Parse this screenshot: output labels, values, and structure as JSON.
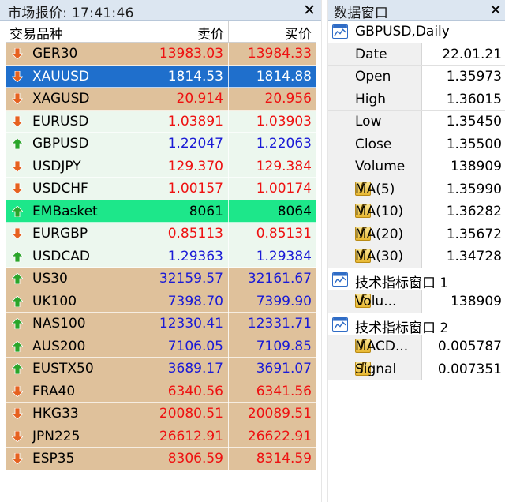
{
  "market_watch": {
    "title": "市场报价: 17:41:46",
    "close_glyph": "✕",
    "columns": {
      "symbol": "交易品种",
      "bid": "卖价",
      "ask": "买价"
    },
    "rows": [
      {
        "symbol": "GER30",
        "bid": "13983.03",
        "ask": "13984.33",
        "direction": "down",
        "bg": "tan",
        "price_color": "red"
      },
      {
        "symbol": "XAUUSD",
        "bid": "1814.53",
        "ask": "1814.88",
        "direction": "down",
        "bg": "blue",
        "price_color": "white"
      },
      {
        "symbol": "XAGUSD",
        "bid": "20.914",
        "ask": "20.956",
        "direction": "down",
        "bg": "tan",
        "price_color": "red"
      },
      {
        "symbol": "EURUSD",
        "bid": "1.03891",
        "ask": "1.03903",
        "direction": "down",
        "bg": "mint",
        "price_color": "red"
      },
      {
        "symbol": "GBPUSD",
        "bid": "1.22047",
        "ask": "1.22063",
        "direction": "up",
        "bg": "mint",
        "price_color": "blue"
      },
      {
        "symbol": "USDJPY",
        "bid": "129.370",
        "ask": "129.384",
        "direction": "down",
        "bg": "mint",
        "price_color": "red"
      },
      {
        "symbol": "USDCHF",
        "bid": "1.00157",
        "ask": "1.00174",
        "direction": "down",
        "bg": "mint",
        "price_color": "red"
      },
      {
        "symbol": "EMBasket",
        "bid": "8061",
        "ask": "8064",
        "direction": "up",
        "bg": "green",
        "price_color": "black"
      },
      {
        "symbol": "EURGBP",
        "bid": "0.85113",
        "ask": "0.85131",
        "direction": "down",
        "bg": "mint",
        "price_color": "red"
      },
      {
        "symbol": "USDCAD",
        "bid": "1.29363",
        "ask": "1.29384",
        "direction": "up",
        "bg": "mint",
        "price_color": "blue"
      },
      {
        "symbol": "US30",
        "bid": "32159.57",
        "ask": "32161.67",
        "direction": "up",
        "bg": "tan",
        "price_color": "blue"
      },
      {
        "symbol": "UK100",
        "bid": "7398.70",
        "ask": "7399.90",
        "direction": "up",
        "bg": "tan",
        "price_color": "blue"
      },
      {
        "symbol": "NAS100",
        "bid": "12330.41",
        "ask": "12331.71",
        "direction": "up",
        "bg": "tan",
        "price_color": "blue"
      },
      {
        "symbol": "AUS200",
        "bid": "7106.05",
        "ask": "7109.85",
        "direction": "up",
        "bg": "tan",
        "price_color": "blue"
      },
      {
        "symbol": "EUSTX50",
        "bid": "3689.17",
        "ask": "3691.07",
        "direction": "up",
        "bg": "tan",
        "price_color": "blue"
      },
      {
        "symbol": "FRA40",
        "bid": "6340.56",
        "ask": "6341.56",
        "direction": "down",
        "bg": "tan",
        "price_color": "red"
      },
      {
        "symbol": "HKG33",
        "bid": "20080.51",
        "ask": "20089.51",
        "direction": "down",
        "bg": "tan",
        "price_color": "red"
      },
      {
        "symbol": "JPN225",
        "bid": "26612.91",
        "ask": "26622.91",
        "direction": "down",
        "bg": "tan",
        "price_color": "red"
      },
      {
        "symbol": "ESP35",
        "bid": "8306.59",
        "ask": "8314.59",
        "direction": "down",
        "bg": "tan",
        "price_color": "red"
      }
    ]
  },
  "data_window": {
    "title": "数据窗口",
    "close_glyph": "✕",
    "rows": [
      {
        "type": "group",
        "icon": "chart-window-icon",
        "text": "GBPUSD,Daily"
      },
      {
        "type": "value",
        "icon": "",
        "label": "Date",
        "value": "22.01.21"
      },
      {
        "type": "value",
        "icon": "",
        "label": "Open",
        "value": "1.35973"
      },
      {
        "type": "value",
        "icon": "",
        "label": "High",
        "value": "1.36015"
      },
      {
        "type": "value",
        "icon": "",
        "label": "Low",
        "value": "1.35450"
      },
      {
        "type": "value",
        "icon": "",
        "label": "Close",
        "value": "1.35500"
      },
      {
        "type": "value",
        "icon": "",
        "label": "Volume",
        "value": "138909"
      },
      {
        "type": "value",
        "icon": "function-icon",
        "label": "MA(5)",
        "value": "1.35990"
      },
      {
        "type": "value",
        "icon": "function-icon",
        "label": "MA(10)",
        "value": "1.36282"
      },
      {
        "type": "value",
        "icon": "function-icon",
        "label": "MA(20)",
        "value": "1.35672"
      },
      {
        "type": "value",
        "icon": "function-icon",
        "label": "MA(30)",
        "value": "1.34728"
      },
      {
        "type": "group",
        "icon": "chart-window-icon",
        "text": "技术指标窗口 1"
      },
      {
        "type": "value",
        "icon": "function-icon",
        "label": "Volu...",
        "value": "138909"
      },
      {
        "type": "group",
        "icon": "chart-window-icon",
        "text": "技术指标窗口 2"
      },
      {
        "type": "value",
        "icon": "function-icon",
        "label": "MACD...",
        "value": "0.005787"
      },
      {
        "type": "value",
        "icon": "function-icon",
        "label": "Signal",
        "value": "0.007351"
      }
    ]
  },
  "colors": {
    "row_tan": "#dfc19b",
    "row_mint": "#ecf7ee",
    "row_selected": "#1f6fcc",
    "row_green": "#1de78a",
    "price_red": "#ee1111",
    "price_blue": "#1a1ad6",
    "arrow_up": "#2aa52a",
    "arrow_down": "#e6611f"
  }
}
